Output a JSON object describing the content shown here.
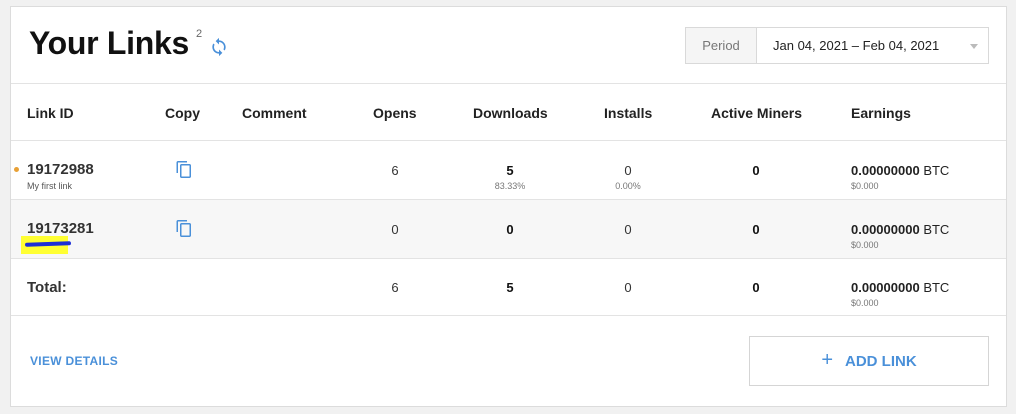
{
  "header": {
    "title": "Your Links",
    "title_sup": "2",
    "period_label": "Period",
    "period_value": "Jan 04, 2021 – Feb 04, 2021"
  },
  "columns": {
    "link_id": "Link ID",
    "copy": "Copy",
    "comment": "Comment",
    "opens": "Opens",
    "downloads": "Downloads",
    "installs": "Installs",
    "active_miners": "Active Miners",
    "earnings": "Earnings"
  },
  "rows": [
    {
      "link_id": "19172988",
      "note": "My first link",
      "opens": "6",
      "downloads": "5",
      "downloads_pct": "83.33%",
      "installs": "0",
      "installs_pct": "0.00%",
      "active_miners": "0",
      "earnings_amount": "0.00000000",
      "earnings_unit": "BTC",
      "earnings_usd": "$0.000"
    },
    {
      "link_id": "19173281",
      "note": "",
      "opens": "0",
      "downloads": "0",
      "downloads_pct": "",
      "installs": "0",
      "installs_pct": "",
      "active_miners": "0",
      "earnings_amount": "0.00000000",
      "earnings_unit": "BTC",
      "earnings_usd": "$0.000"
    }
  ],
  "total": {
    "label": "Total:",
    "opens": "6",
    "downloads": "5",
    "installs": "0",
    "active_miners": "0",
    "earnings_amount": "0.00000000",
    "earnings_unit": "BTC",
    "earnings_usd": "$0.000"
  },
  "footer": {
    "view_details": "VIEW DETAILS",
    "add_link": "ADD LINK"
  },
  "colors": {
    "accent": "#4a90d9",
    "dot": "#e8a035"
  },
  "icons": {
    "refresh": "refresh-icon",
    "copy": "copy-icon",
    "plus": "plus-icon"
  }
}
